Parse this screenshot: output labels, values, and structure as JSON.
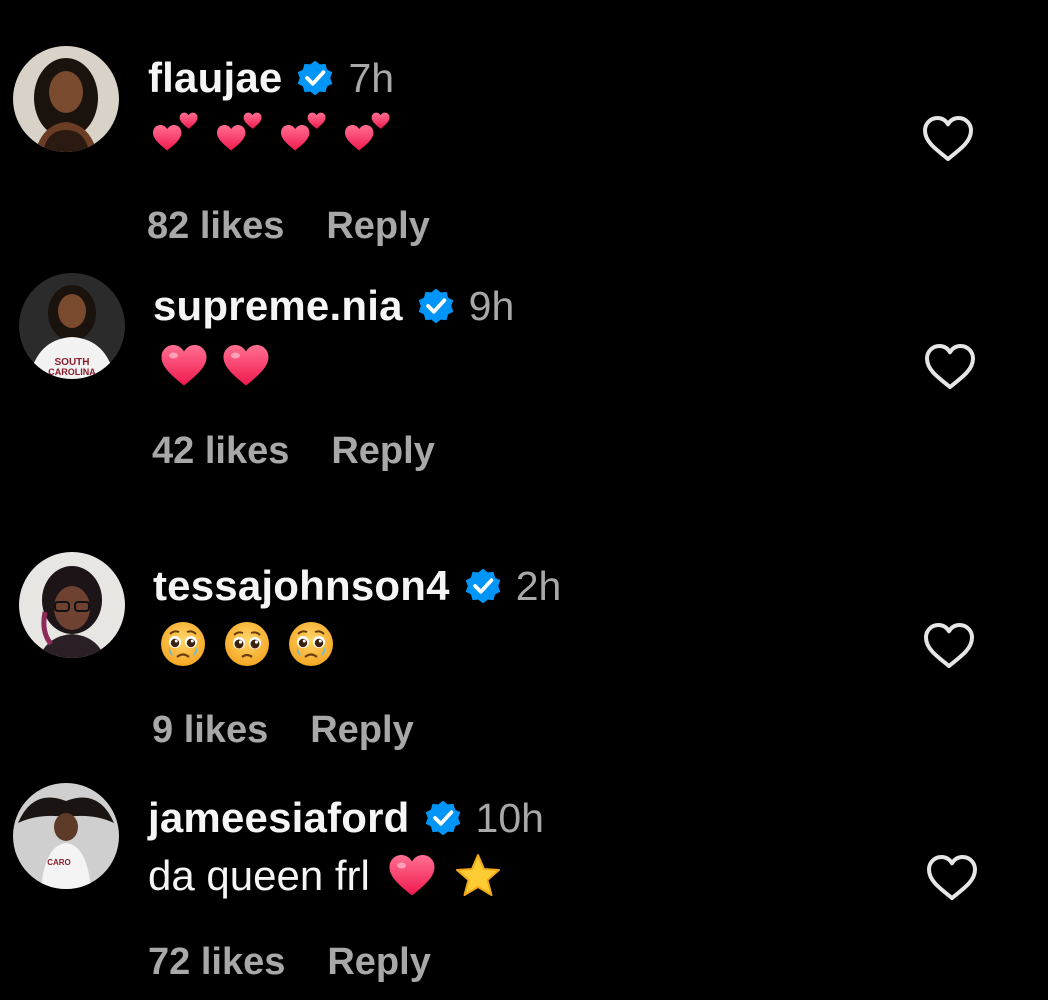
{
  "comments": [
    {
      "username": "flaujae",
      "verified": true,
      "time": "7h",
      "text": "",
      "emojis": [
        "two-hearts",
        "two-hearts",
        "two-hearts",
        "two-hearts"
      ],
      "likes": "82 likes",
      "reply": "Reply"
    },
    {
      "username": "supreme.nia",
      "verified": true,
      "time": "9h",
      "text": "",
      "emojis": [
        "red-heart",
        "red-heart"
      ],
      "likes": "42 likes",
      "reply": "Reply"
    },
    {
      "username": "tessajohnson4",
      "verified": true,
      "time": "2h",
      "text": "",
      "emojis": [
        "holding-back-tears",
        "pleading-face",
        "holding-back-tears"
      ],
      "likes": "9 likes",
      "reply": "Reply"
    },
    {
      "username": "jameesiaford",
      "verified": true,
      "time": "10h",
      "text": "da queen frl",
      "emojis": [
        "red-heart",
        "star"
      ],
      "likes": "72 likes",
      "reply": "Reply"
    }
  ],
  "colors": {
    "background": "#000000",
    "primary_text": "#f5f5f5",
    "secondary_text": "#a8a8a8",
    "verified_blue": "#0095f6",
    "heart_pink": "#ff3b6b",
    "star_yellow": "#ffcc33"
  }
}
